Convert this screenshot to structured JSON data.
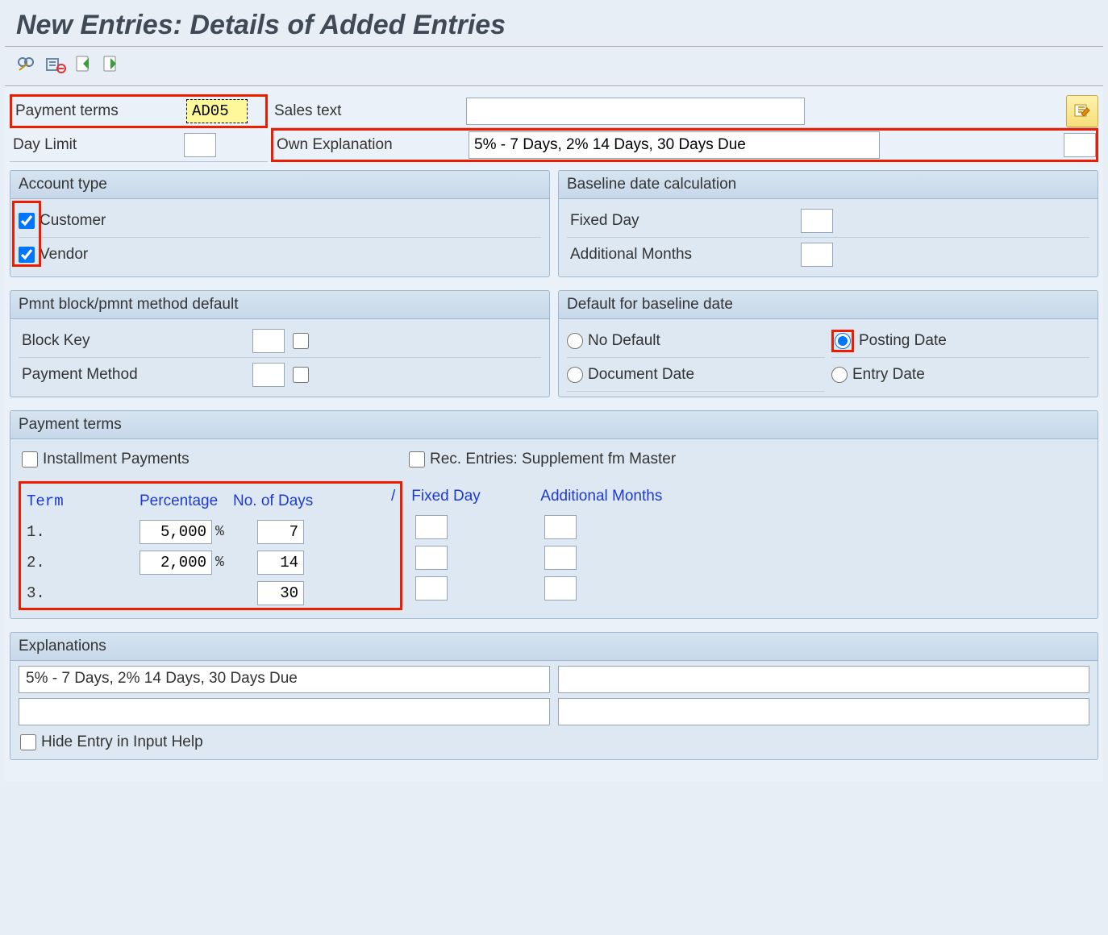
{
  "title": "New Entries: Details of Added Entries",
  "header_fields": {
    "payment_terms_label": "Payment terms",
    "payment_terms_value": "AD05",
    "day_limit_label": "Day Limit",
    "day_limit_value": "",
    "sales_text_label": "Sales text",
    "sales_text_value": "",
    "own_explanation_label": "Own Explanation",
    "own_explanation_value": "5% - 7 Days, 2% 14 Days, 30 Days Due"
  },
  "account_type": {
    "title": "Account type",
    "customer_label": "Customer",
    "customer_checked": true,
    "vendor_label": "Vendor",
    "vendor_checked": true
  },
  "baseline_calc": {
    "title": "Baseline date calculation",
    "fixed_day_label": "Fixed Day",
    "fixed_day_value": "",
    "additional_months_label": "Additional Months",
    "additional_months_value": ""
  },
  "pmnt_block": {
    "title": "Pmnt block/pmnt method default",
    "block_key_label": "Block Key",
    "block_key_value": "",
    "payment_method_label": "Payment Method",
    "payment_method_value": ""
  },
  "baseline_default": {
    "title": "Default for baseline date",
    "no_default": "No Default",
    "posting_date": "Posting Date",
    "document_date": "Document Date",
    "entry_date": "Entry Date",
    "selected": "posting_date"
  },
  "payment_terms": {
    "title": "Payment terms",
    "installment_label": "Installment Payments",
    "rec_entries_label": "Rec. Entries: Supplement fm Master",
    "th_term": "Term",
    "th_percentage": "Percentage",
    "th_days": "No. of Days",
    "slash": "/",
    "th_fixed_day": "Fixed Day",
    "th_add_months": "Additional Months",
    "percent_symbol": "%",
    "rows": [
      {
        "term": "1.",
        "percentage": "5,000",
        "days": "7",
        "fixed_day": "",
        "add_months": ""
      },
      {
        "term": "2.",
        "percentage": "2,000",
        "days": "14",
        "fixed_day": "",
        "add_months": ""
      },
      {
        "term": "3.",
        "percentage": "",
        "days": "30",
        "fixed_day": "",
        "add_months": ""
      }
    ]
  },
  "explanations": {
    "title": "Explanations",
    "line1_left": "5% - 7 Days, 2% 14 Days, 30 Days Due",
    "line1_right": "",
    "line2_left": "",
    "line2_right": "",
    "hide_entry_label": "Hide Entry in Input Help"
  }
}
